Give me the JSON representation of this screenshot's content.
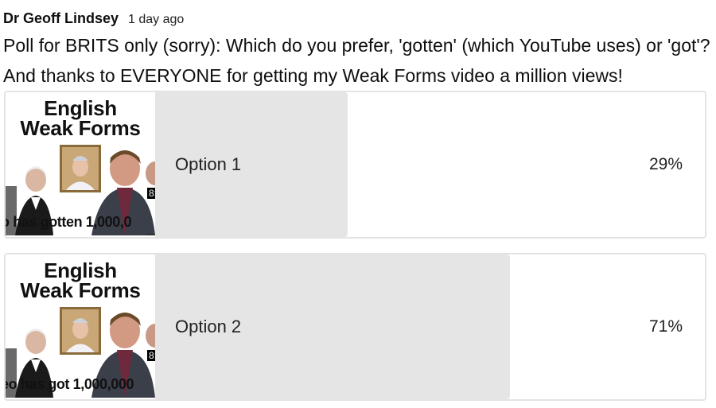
{
  "post": {
    "author": "Dr Geoff Lindsey",
    "time": "1 day ago",
    "line1": "Poll for BRITS only (sorry): Which do you prefer, 'gotten' (which YouTube uses) or 'got'?",
    "line2": "And thanks to EVERYONE for getting my Weak Forms video a million views!"
  },
  "poll": {
    "options": [
      {
        "label": "Option 1",
        "percent_text": "29%",
        "percent": 29,
        "thumb_title_1": "English",
        "thumb_title_2": "Weak Forms",
        "thumb_caption": "o has gotten 1,000,0",
        "thumb_badge": "8:"
      },
      {
        "label": "Option 2",
        "percent_text": "71%",
        "percent": 71,
        "thumb_title_1": "English",
        "thumb_title_2": "Weak Forms",
        "thumb_caption": "eo has got 1,000,000",
        "thumb_badge": "8:"
      }
    ]
  },
  "colors": {
    "fill": "#e5e5e5",
    "border": "#e3e3e3",
    "text": "#0f0f0f"
  }
}
